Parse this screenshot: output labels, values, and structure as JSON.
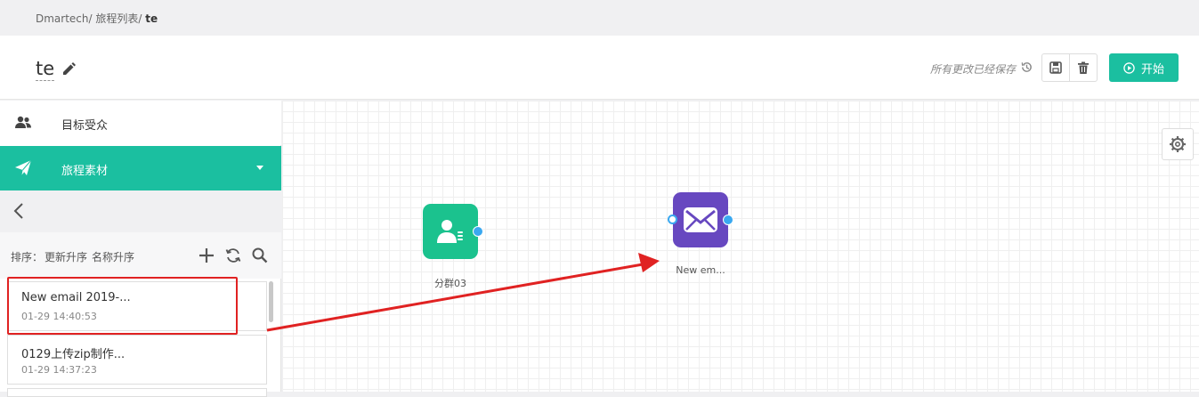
{
  "breadcrumb": {
    "items": [
      "Dmartech/",
      "旅程列表/"
    ],
    "current": "te"
  },
  "header": {
    "title": "te",
    "save_status": "所有更改已经保存",
    "start_label": "开始",
    "accent_color": "#1bbfa0"
  },
  "sidebar": {
    "nav": [
      {
        "label": "目标受众",
        "icon": "users-icon",
        "active": false
      },
      {
        "label": "旅程素材",
        "icon": "paper-plane-icon",
        "active": true
      }
    ],
    "sort": {
      "prefix": "排序：",
      "options": [
        "更新升序",
        "名称升序"
      ]
    },
    "tools": [
      "plus-icon",
      "refresh-icon",
      "search-icon"
    ],
    "items": [
      {
        "title": "New email 2019-...",
        "time": "01-29 14:40:53",
        "highlighted": true
      },
      {
        "title": "0129上传zip制作...",
        "time": "01-29 14:37:23",
        "highlighted": false
      }
    ]
  },
  "canvas": {
    "nodes": [
      {
        "label": "分群03",
        "icon": "segment-user-icon",
        "color": "#1bc28e"
      },
      {
        "label": "New em...",
        "icon": "envelope-icon",
        "color": "#6748c0"
      }
    ],
    "annotation_color": "#e02222"
  }
}
